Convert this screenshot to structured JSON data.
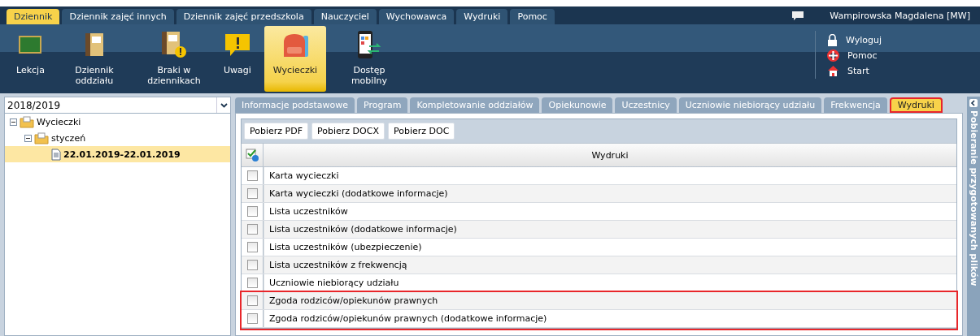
{
  "menu_tabs": [
    {
      "label": "Dziennik",
      "selected": true
    },
    {
      "label": "Dziennik zajęć innych",
      "selected": false
    },
    {
      "label": "Dziennik zajęć przedszkola",
      "selected": false
    },
    {
      "label": "Nauczyciel",
      "selected": false
    },
    {
      "label": "Wychowawca",
      "selected": false
    },
    {
      "label": "Wydruki",
      "selected": false
    },
    {
      "label": "Pomoc",
      "selected": false
    }
  ],
  "user": "Wampirowska Magdalena [MW]",
  "toolbar": [
    {
      "kind": "board",
      "label": "Lekcja",
      "selected": false
    },
    {
      "kind": "book",
      "label": "Dziennik oddziału",
      "selected": false
    },
    {
      "kind": "bookwarn",
      "label": "Braki w dziennikach",
      "selected": false
    },
    {
      "kind": "note",
      "label": "Uwagi",
      "selected": false
    },
    {
      "kind": "backpack",
      "label": "Wycieczki",
      "selected": true
    },
    {
      "kind": "phone",
      "label": "Dostęp mobilny",
      "selected": false
    }
  ],
  "quick_links": [
    {
      "kind": "lock",
      "label": "Wyloguj"
    },
    {
      "kind": "lifebuoy",
      "label": "Pomoc"
    },
    {
      "kind": "home",
      "label": "Start"
    }
  ],
  "year_select": {
    "value": "2018/2019"
  },
  "tree": [
    {
      "kind": "folder",
      "label": "Wycieczki",
      "expanded": true,
      "selected": false,
      "children": [
        {
          "kind": "folder",
          "label": "styczeń",
          "expanded": true,
          "selected": false,
          "children": [
            {
              "kind": "file",
              "label": "22.01.2019-22.01.2019",
              "selected": true
            }
          ]
        }
      ]
    }
  ],
  "tabs": [
    {
      "label": "Informacje podstawowe",
      "selected": false,
      "highlighted": false
    },
    {
      "label": "Program",
      "selected": false,
      "highlighted": false
    },
    {
      "label": "Kompletowanie oddziałów",
      "selected": false,
      "highlighted": false
    },
    {
      "label": "Opiekunowie",
      "selected": false,
      "highlighted": false
    },
    {
      "label": "Uczestnicy",
      "selected": false,
      "highlighted": false
    },
    {
      "label": "Uczniowie niebiorący udziału",
      "selected": false,
      "highlighted": false
    },
    {
      "label": "Frekwencja",
      "selected": false,
      "highlighted": false
    },
    {
      "label": "Wydruki",
      "selected": true,
      "highlighted": true
    }
  ],
  "buttons": [
    "Pobierz PDF",
    "Pobierz DOCX",
    "Pobierz DOC"
  ],
  "table": {
    "column": "Wydruki",
    "rows": [
      {
        "label": "Karta wycieczki",
        "checked": false,
        "highlighted": false
      },
      {
        "label": "Karta wycieczki (dodatkowe informacje)",
        "checked": false,
        "highlighted": false
      },
      {
        "label": "Lista uczestników",
        "checked": false,
        "highlighted": false
      },
      {
        "label": "Lista uczestników (dodatkowe informacje)",
        "checked": false,
        "highlighted": false
      },
      {
        "label": "Lista uczestników (ubezpieczenie)",
        "checked": false,
        "highlighted": false
      },
      {
        "label": "Lista uczestników z frekwencją",
        "checked": false,
        "highlighted": false
      },
      {
        "label": "Uczniowie niebiorący udziału",
        "checked": false,
        "highlighted": false
      },
      {
        "label": "Zgoda rodziców/opiekunów prawnych",
        "checked": false,
        "highlighted": true
      },
      {
        "label": "Zgoda rodziców/opiekunów prawnych (dodatkowe informacje)",
        "checked": false,
        "highlighted": true
      }
    ]
  },
  "side_panel": {
    "title": "Pobieranie przygotowanych plików"
  }
}
